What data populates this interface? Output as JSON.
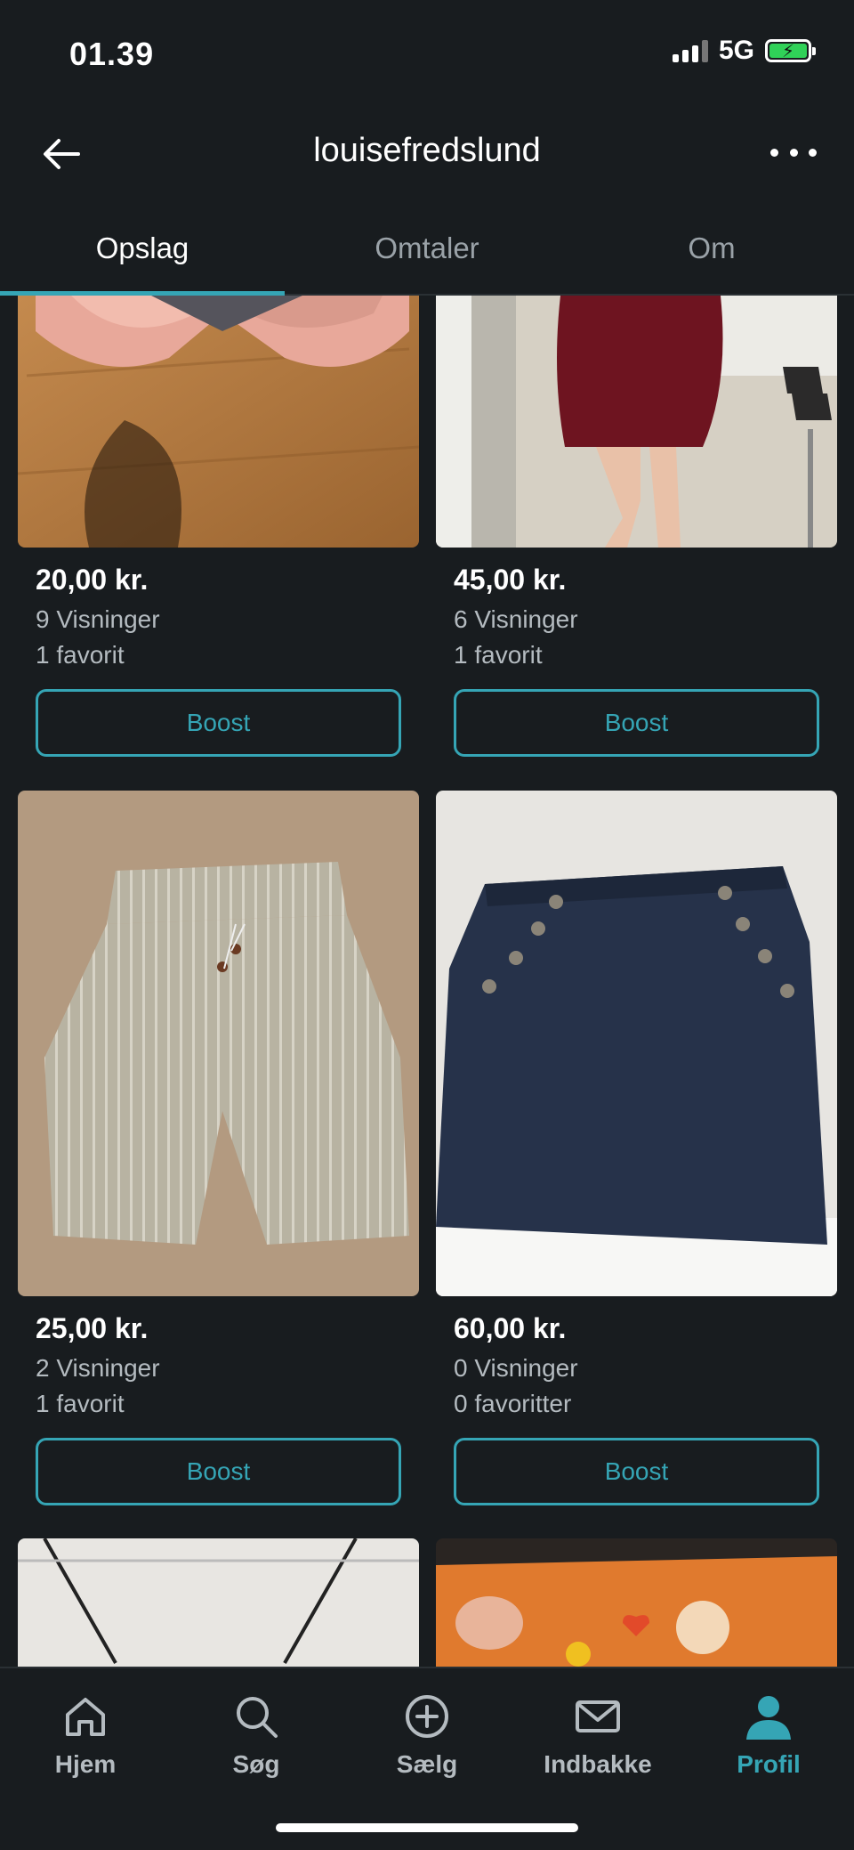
{
  "status_bar": {
    "time": "01.39",
    "network": "5G"
  },
  "header": {
    "title": "louisefredslund"
  },
  "tabs": [
    {
      "label": "Opslag",
      "active": true
    },
    {
      "label": "Omtaler",
      "active": false
    },
    {
      "label": "Om",
      "active": false
    }
  ],
  "listings": [
    {
      "price": "20,00 kr.",
      "views": "9 Visninger",
      "favorites": "1 favorit",
      "boost": "Boost"
    },
    {
      "price": "45,00 kr.",
      "views": "6 Visninger",
      "favorites": "1 favorit",
      "boost": "Boost"
    },
    {
      "price": "25,00 kr.",
      "views": "2 Visninger",
      "favorites": "1 favorit",
      "boost": "Boost"
    },
    {
      "price": "60,00 kr.",
      "views": "0 Visninger",
      "favorites": "0 favoritter",
      "boost": "Boost"
    }
  ],
  "bottom_nav": [
    {
      "label": "Hjem",
      "icon": "home-icon"
    },
    {
      "label": "Søg",
      "icon": "search-icon"
    },
    {
      "label": "Sælg",
      "icon": "plus-circle-icon"
    },
    {
      "label": "Indbakke",
      "icon": "mail-icon"
    },
    {
      "label": "Profil",
      "icon": "profile-icon",
      "active": true
    }
  ],
  "colors": {
    "accent": "#35a5b5",
    "background": "#181c1f",
    "battery": "#30d158"
  }
}
